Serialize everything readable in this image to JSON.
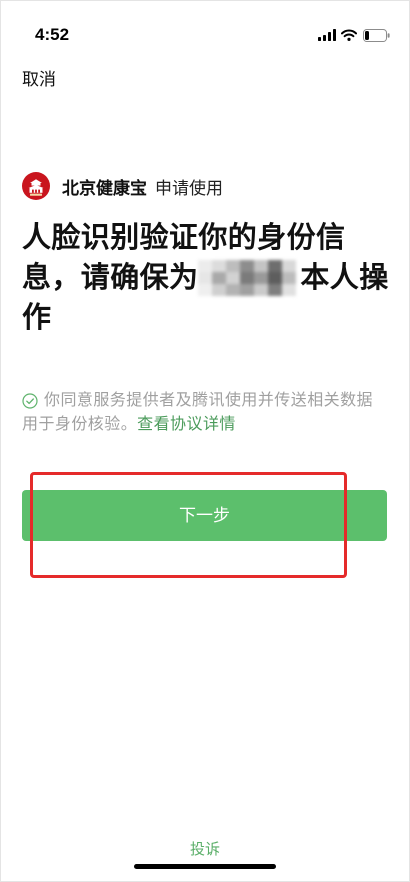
{
  "status_bar": {
    "time": "4:52",
    "icons": [
      "signal-icon",
      "wifi-icon",
      "battery-icon"
    ],
    "battery_level": 0.2
  },
  "header": {
    "cancel_label": "取消"
  },
  "app": {
    "logo_icon": "beijing-health-logo-icon",
    "name": "北京健康宝",
    "action": "申请使用"
  },
  "title": {
    "line1": "人脸识别验证你的身份信",
    "line2_prefix": "息，请确保为",
    "line2_suffix": "本人操",
    "line3": "作"
  },
  "agreement": {
    "icon": "check-circle-icon",
    "line1": "你同意服务提供者及腾讯使用并传送相关数据",
    "line2": "用于身份核验。",
    "link_label": "查看协议详情"
  },
  "button": {
    "label": "下一步"
  },
  "footer": {
    "complaint_label": "投诉"
  },
  "colors": {
    "brand-green": "#5cbf6c",
    "link-green": "#4b9b5b",
    "footer-green": "#5aae68",
    "text-gray": "#a0a0a0",
    "title-color": "#111111",
    "annotation-red": "#e52a2a",
    "logo-red": "#c9151e",
    "check-green": "#5fb36d"
  }
}
